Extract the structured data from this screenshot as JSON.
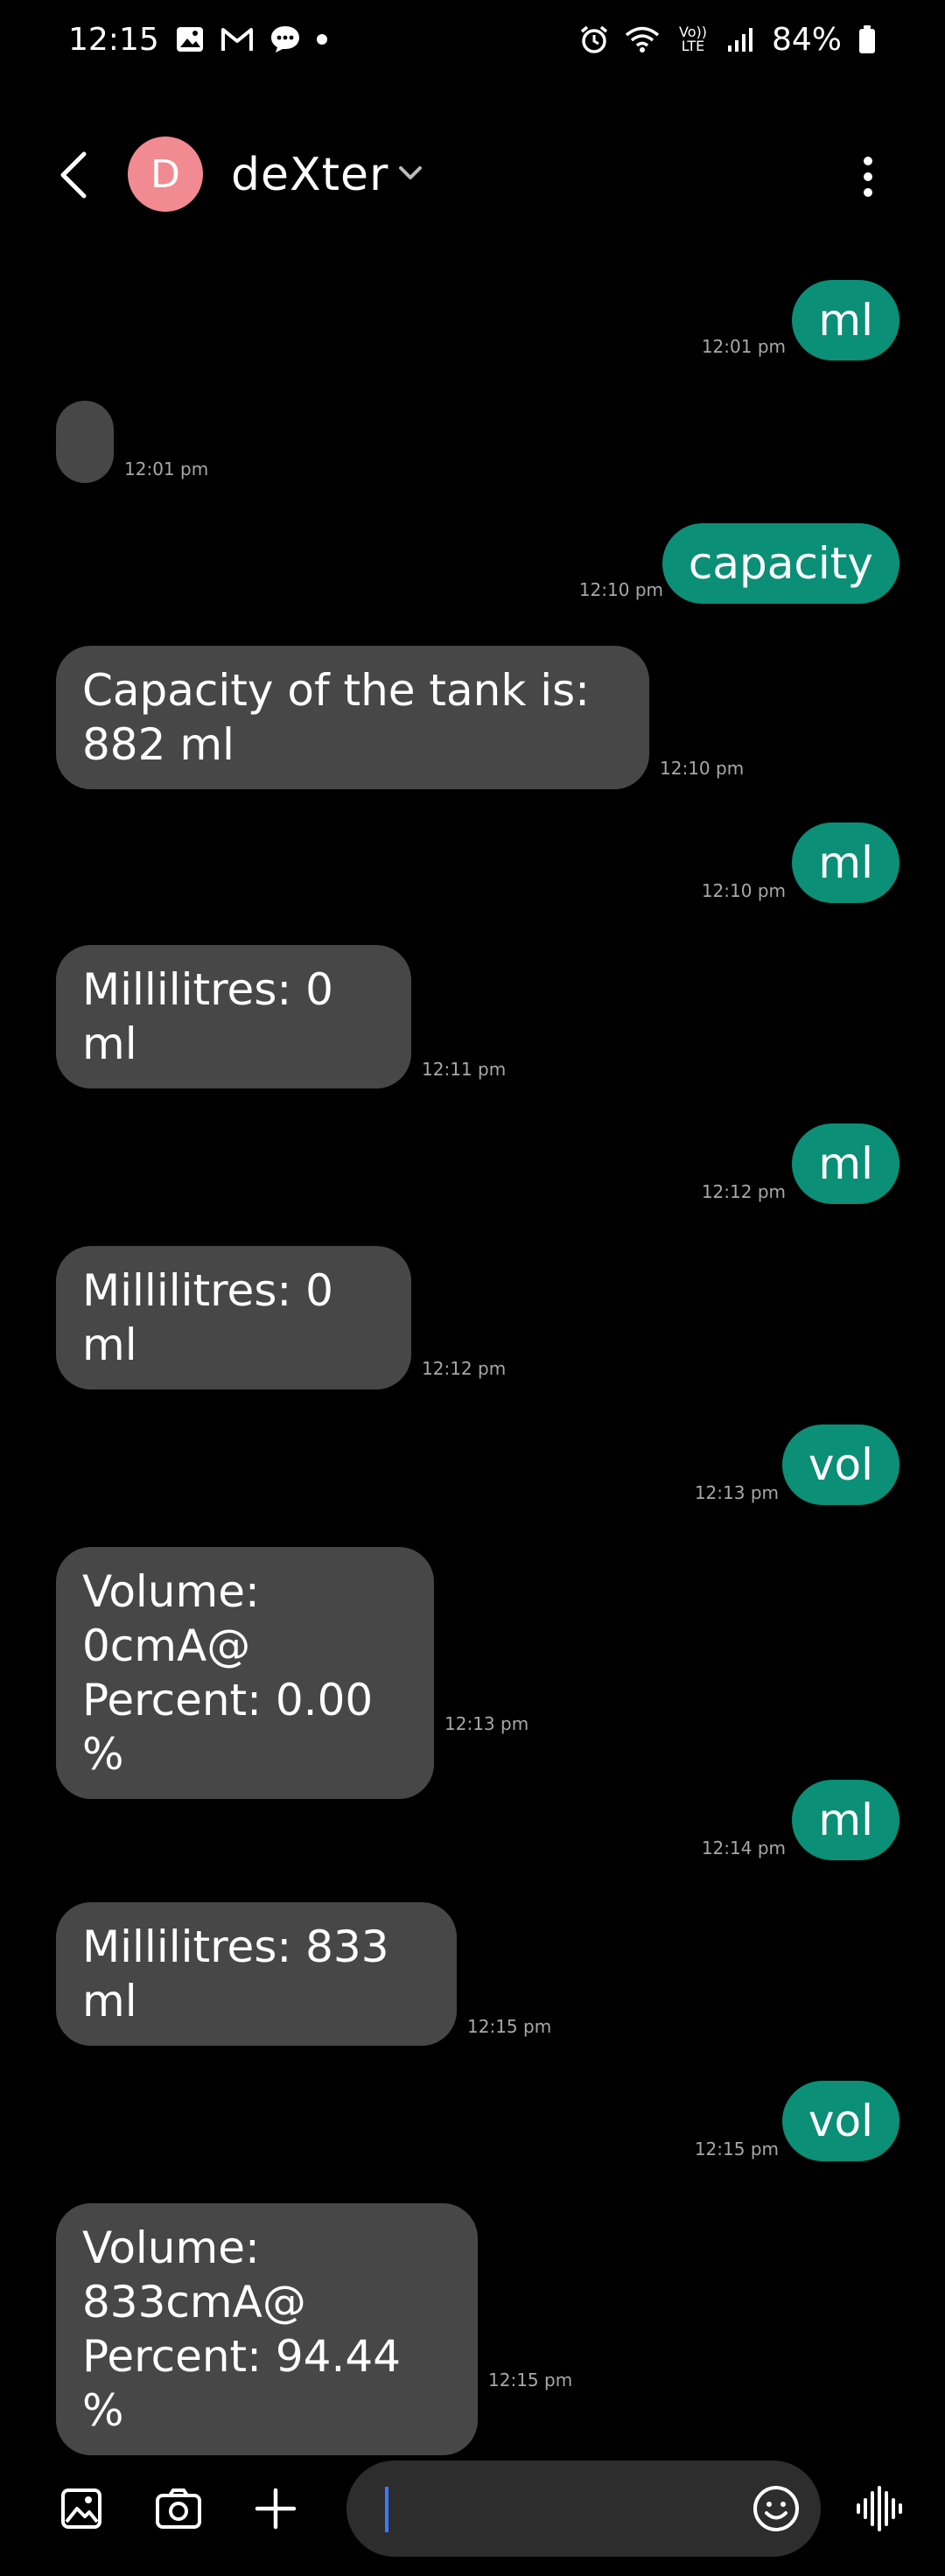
{
  "status_bar": {
    "time": "12:15",
    "network": "Vo)) LTE",
    "battery": "84%"
  },
  "header": {
    "avatar_letter": "D",
    "contact_name": "deXter"
  },
  "messages": [
    {
      "direction": "sent",
      "text": "ml",
      "time": "12:01 pm"
    },
    {
      "direction": "received",
      "text": "",
      "time": "12:01 pm"
    },
    {
      "direction": "sent",
      "text": "capacity",
      "time": "12:10 pm"
    },
    {
      "direction": "received",
      "text": "Capacity of the tank is:\n882 ml",
      "time": "12:10 pm"
    },
    {
      "direction": "sent",
      "text": "ml",
      "time": "12:10 pm"
    },
    {
      "direction": "received",
      "text": "Millilitres: 0 ml\n ",
      "time": "12:11 pm"
    },
    {
      "direction": "sent",
      "text": "ml",
      "time": "12:12 pm"
    },
    {
      "direction": "received",
      "text": "Millilitres: 0 ml\n ",
      "time": "12:12 pm"
    },
    {
      "direction": "sent",
      "text": "vol",
      "time": "12:13 pm"
    },
    {
      "direction": "received",
      "text": "Volume: 0cmA@\nPercent: 0.00 %\n ",
      "time": "12:13 pm"
    },
    {
      "direction": "sent",
      "text": "ml",
      "time": "12:14 pm"
    },
    {
      "direction": "received",
      "text": "Millilitres: 833 ml\n ",
      "time": "12:15 pm"
    },
    {
      "direction": "sent",
      "text": "vol",
      "time": "12:15 pm"
    },
    {
      "direction": "received",
      "text": "Volume: 833cmA@\nPercent: 94.44 %\n ",
      "time": "12:15 pm"
    }
  ],
  "composer": {
    "placeholder": ""
  }
}
